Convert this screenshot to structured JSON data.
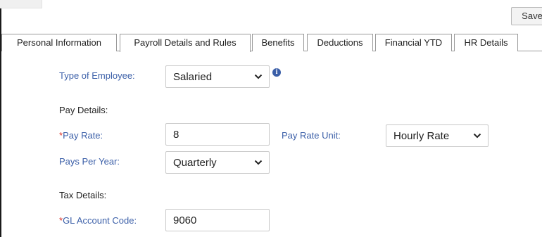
{
  "toolbar": {
    "save_label": "Save"
  },
  "tabs": [
    {
      "label": "Personal Information"
    },
    {
      "label": "Payroll Details and Rules",
      "active": true
    },
    {
      "label": "Benefits"
    },
    {
      "label": "Deductions"
    },
    {
      "label": "Financial YTD"
    },
    {
      "label": "HR Details"
    }
  ],
  "form": {
    "type_of_employee": {
      "label": "Type of Employee:",
      "value": "Salaried",
      "info_icon": "info-icon"
    },
    "pay_details": {
      "heading": "Pay Details:"
    },
    "pay_rate": {
      "required_marker": "*",
      "label": "Pay Rate:",
      "value": "8"
    },
    "pay_rate_unit": {
      "label": "Pay Rate Unit:",
      "value": "Hourly Rate"
    },
    "pays_per_year": {
      "label": "Pays Per Year:",
      "value": "Quarterly"
    },
    "tax_details": {
      "heading": "Tax Details:"
    },
    "gl_account_code": {
      "required_marker": "*",
      "label": "GL Account Code:",
      "value": "9060"
    }
  },
  "colors": {
    "label_blue": "#3b5fa8",
    "required_red": "#d9342b",
    "border_grey": "#9a9a9a"
  }
}
